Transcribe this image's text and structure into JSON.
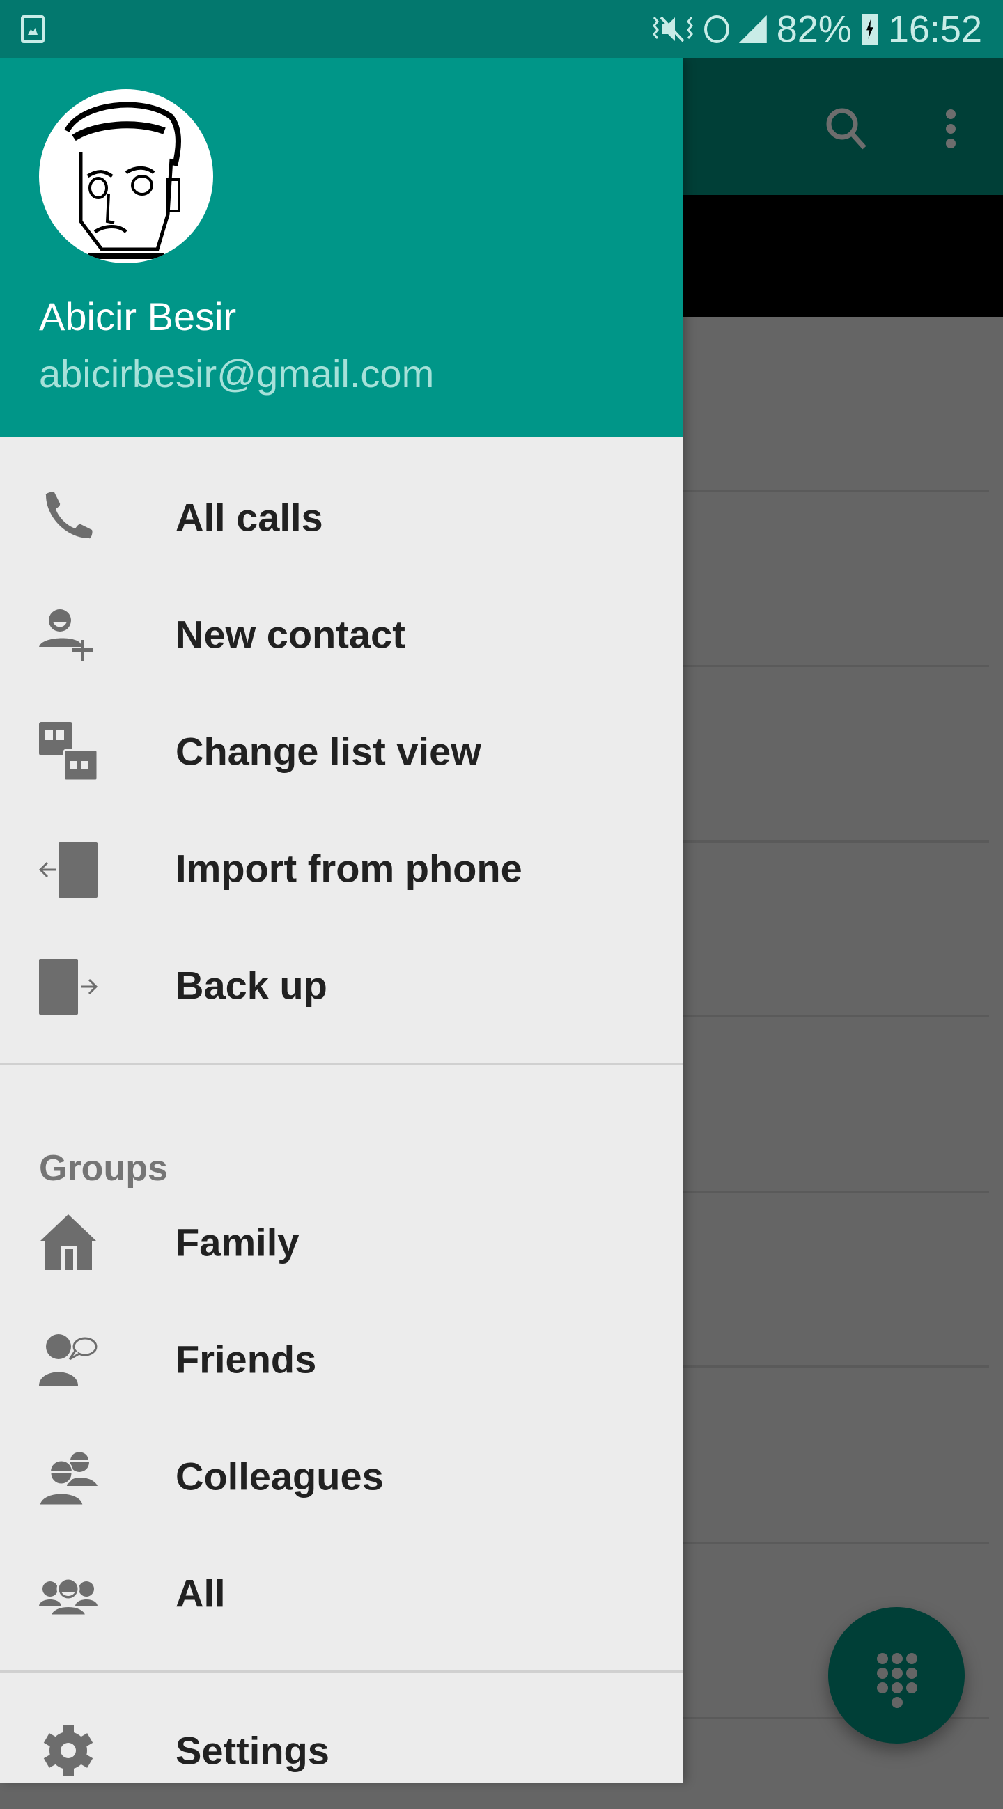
{
  "status_bar": {
    "left_icon": "gallery-notification-icon",
    "icons": [
      "vibrate-mute-icon",
      "alarm-icon",
      "signal-icon"
    ],
    "battery_percent": "82%",
    "battery_icon": "battery-charging-icon",
    "time": "16:52"
  },
  "app_bar": {
    "actions": [
      "search-icon",
      "more-vert-icon"
    ]
  },
  "fab": {
    "icon": "dialpad-icon"
  },
  "drawer": {
    "header": {
      "avatar": "user-avatar-sketch",
      "name": "Abicir Besir",
      "email": "abicirbesir@gmail.com"
    },
    "main_items": [
      {
        "label": "All calls",
        "icon": "phone-icon"
      },
      {
        "label": "New contact",
        "icon": "add-person-icon"
      },
      {
        "label": "Change list view",
        "icon": "list-view-icon"
      },
      {
        "label": "Import from phone",
        "icon": "import-icon"
      },
      {
        "label": "Back up",
        "icon": "export-icon"
      }
    ],
    "groups_label": "Groups",
    "group_items": [
      {
        "label": "Family",
        "icon": "home-icon"
      },
      {
        "label": "Friends",
        "icon": "friend-chat-icon"
      },
      {
        "label": "Colleagues",
        "icon": "colleagues-icon"
      },
      {
        "label": "All",
        "icon": "group-icon"
      }
    ],
    "footer_items": [
      {
        "label": "Settings",
        "icon": "settings-gear-icon"
      }
    ]
  },
  "colors": {
    "status_bar": "#03786e",
    "header": "#009688",
    "drawer_bg": "#ececec",
    "icon_gray": "#6d6d6d",
    "text_dark": "#212121",
    "email_text": "#a6e1d9",
    "dimmed_toolbar": "#003f37"
  }
}
